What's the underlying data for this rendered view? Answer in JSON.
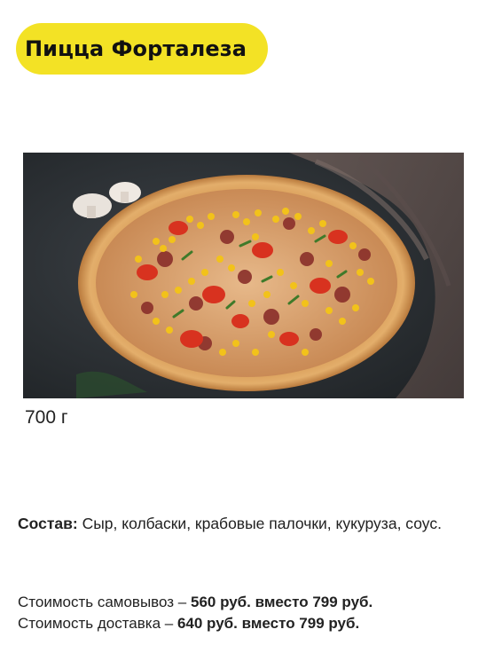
{
  "product": {
    "title": "Пицца Форталеза",
    "image_alt": "pizza-photo",
    "weight": "700 г"
  },
  "composition": {
    "label": "Состав:",
    "text": " Сыр, колбаски, крабовые палочки, кукуруза, соус."
  },
  "prices": {
    "pickup": {
      "label": "Стоимость самовывоз – ",
      "value": "560 руб. вместо 799 руб."
    },
    "delivery": {
      "label": "Стоимость доставка – ",
      "value": "640 руб. вместо 799 руб."
    }
  },
  "colors": {
    "title_pill": "#f3e225",
    "text": "#222222",
    "background": "#ffffff"
  }
}
